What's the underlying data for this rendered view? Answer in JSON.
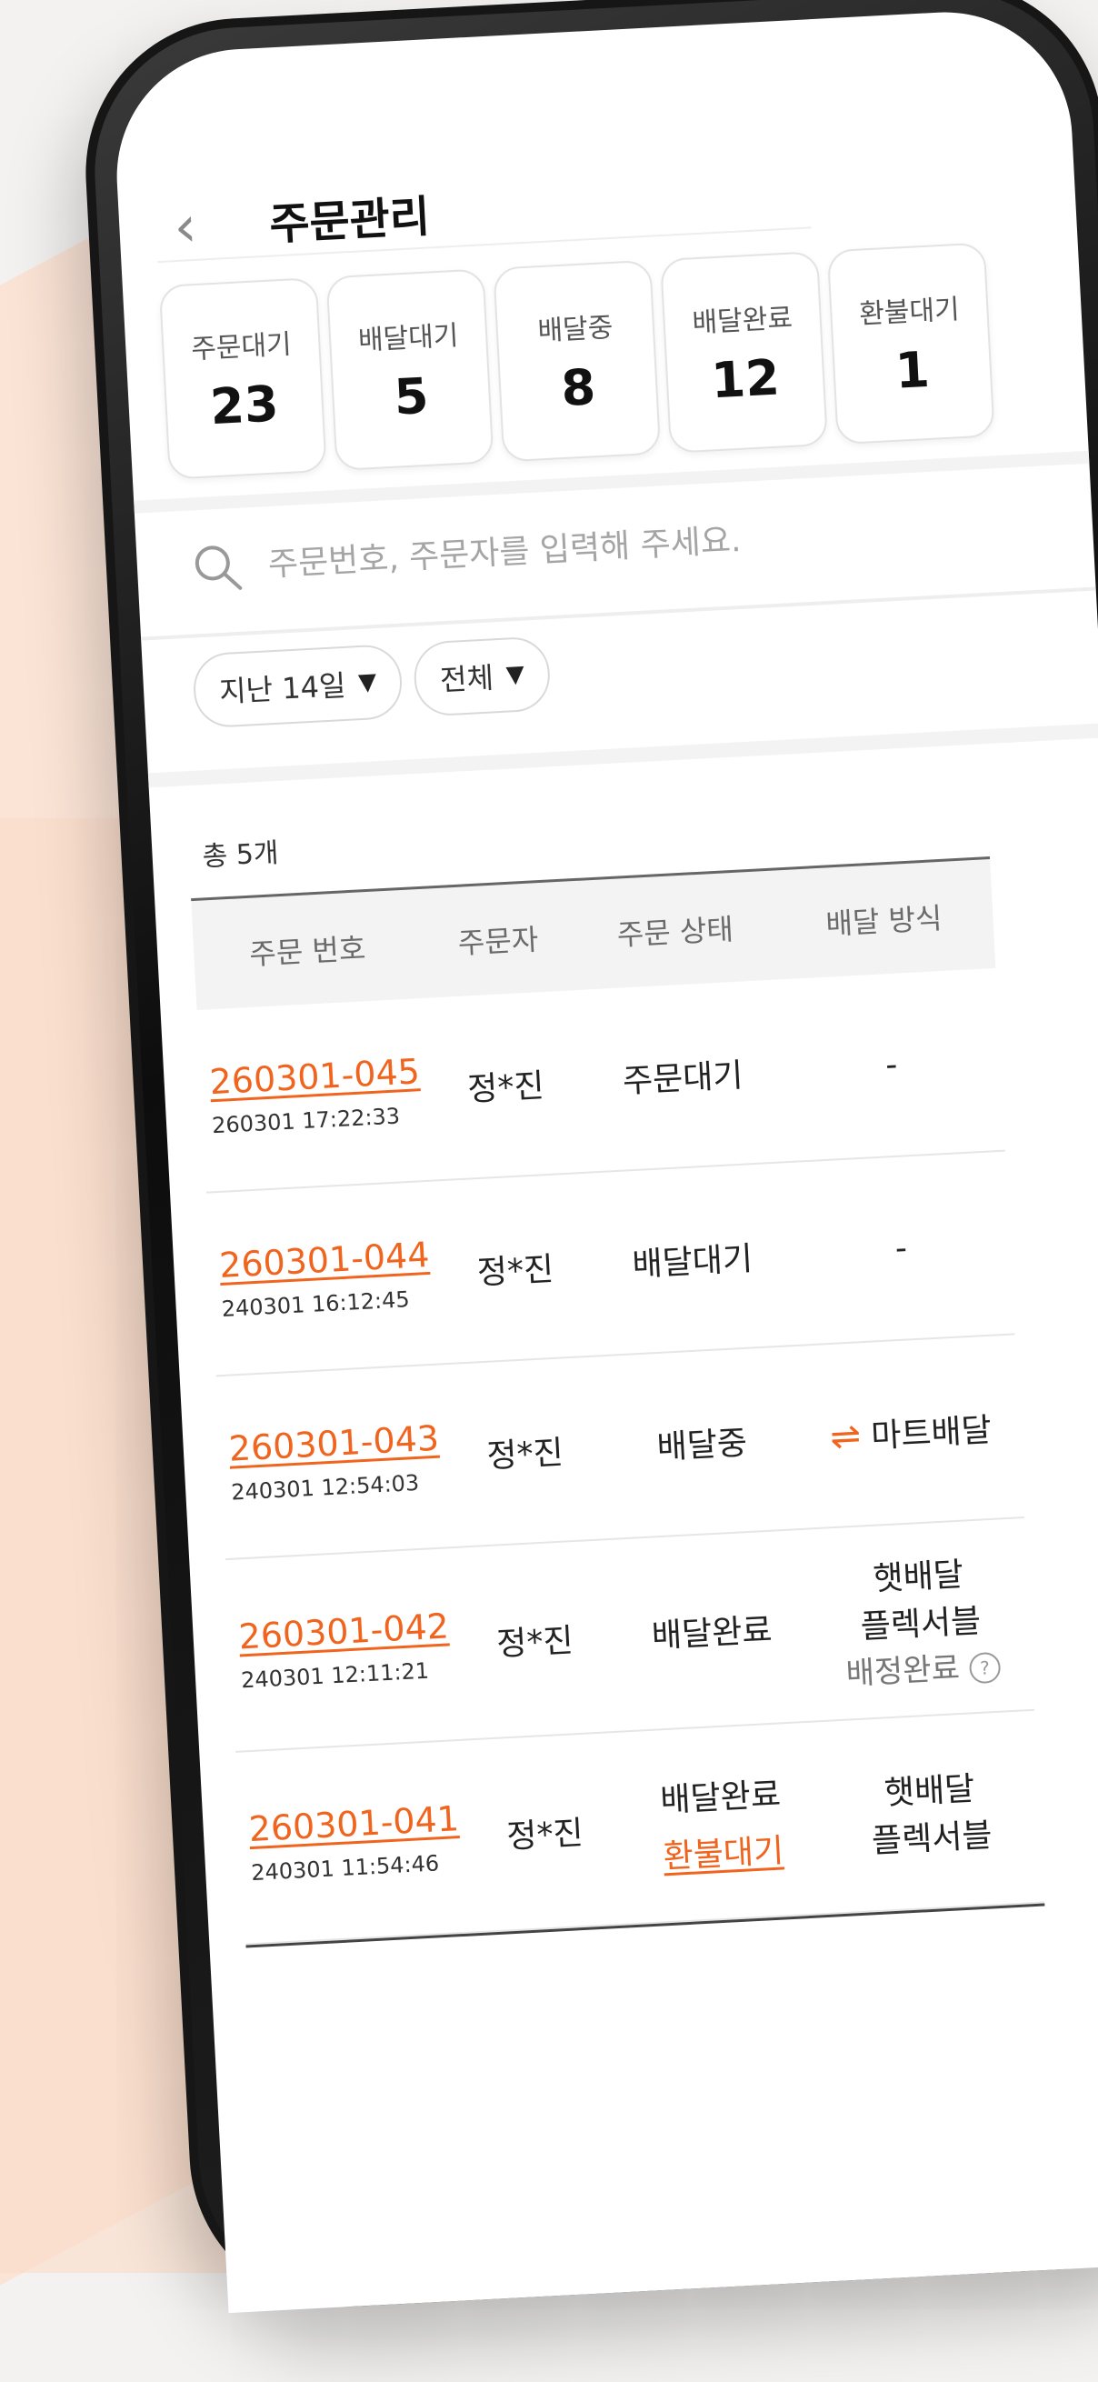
{
  "header": {
    "title": "주문관리",
    "back_icon": "chevron-left-icon"
  },
  "stats": [
    {
      "label": "주문대기",
      "count": "23"
    },
    {
      "label": "배달대기",
      "count": "5"
    },
    {
      "label": "배달중",
      "count": "8"
    },
    {
      "label": "배달완료",
      "count": "12"
    },
    {
      "label": "환불대기",
      "count": "1"
    }
  ],
  "search": {
    "placeholder": "주문번호, 주문자를 입력해 주세요.",
    "icon": "search-icon"
  },
  "filters": [
    {
      "label": "지난 14일"
    },
    {
      "label": "전체"
    }
  ],
  "total_label": "총 5개",
  "table": {
    "headers": [
      "주문 번호",
      "주문자",
      "주문 상태",
      "배달 방식"
    ],
    "rows": [
      {
        "order_id": "260301-045",
        "time": "260301 17:22:33",
        "customer": "정*진",
        "status": "주문대기",
        "method": "-"
      },
      {
        "order_id": "260301-044",
        "time": "240301 16:12:45",
        "customer": "정*진",
        "status": "배달대기",
        "method": "-"
      },
      {
        "order_id": "260301-043",
        "time": "240301 12:54:03",
        "customer": "정*진",
        "status": "배달중",
        "method_icon": "⇌",
        "method": "마트배달"
      },
      {
        "order_id": "260301-042",
        "time": "240301 12:11:21",
        "customer": "정*진",
        "status": "배달완료",
        "method_line1": "햇배달",
        "method_line2": "플렉서블",
        "method_sub": "배정완료"
      },
      {
        "order_id": "260301-041",
        "time": "240301 11:54:46",
        "customer": "정*진",
        "status": "배달완료",
        "status_sub": "환불대기",
        "method_line1": "햇배달",
        "method_line2": "플렉서블"
      }
    ]
  },
  "colors": {
    "accent": "#f0641e",
    "background_wash": "#fbe4d6"
  }
}
